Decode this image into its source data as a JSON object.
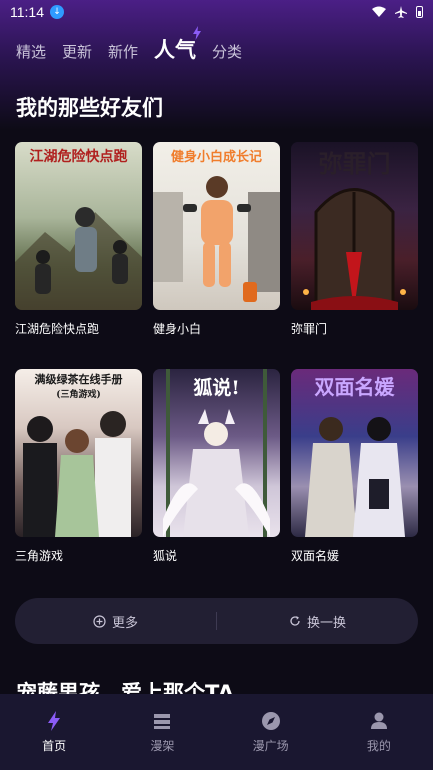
{
  "status": {
    "time": "11:14"
  },
  "tabs": [
    {
      "label": "精选"
    },
    {
      "label": "更新"
    },
    {
      "label": "新作"
    },
    {
      "label": "人气",
      "active": true
    },
    {
      "label": "分类"
    }
  ],
  "section": {
    "title": "我的那些好友们"
  },
  "cards": [
    {
      "cover_text": "江湖危险快点跑",
      "name": "江湖危险快点跑"
    },
    {
      "cover_text": "健身小白成长记",
      "name": "健身小白"
    },
    {
      "cover_text": "弥罪门",
      "name": "弥罪门"
    },
    {
      "cover_text": "满级绿茶在线手册",
      "cover_sub": "(三角游戏)",
      "name": "三角游戏"
    },
    {
      "cover_text": "狐说!",
      "name": "狐说"
    },
    {
      "cover_text": "双面名媛",
      "name": "双面名媛"
    }
  ],
  "actions": {
    "more_label": "更多",
    "refresh_label": "换一换"
  },
  "next_section": {
    "title": "宠藤男孩，爱上那个TA"
  },
  "nav": [
    {
      "label": "首页",
      "icon": "bolt-icon",
      "active": true
    },
    {
      "label": "漫架",
      "icon": "shelf-icon"
    },
    {
      "label": "漫广场",
      "icon": "compass-icon"
    },
    {
      "label": "我的",
      "icon": "user-icon"
    }
  ],
  "colors": {
    "accent": "#8b5cf6",
    "background": "#0d0b16",
    "nav_bg": "#1a1730"
  }
}
